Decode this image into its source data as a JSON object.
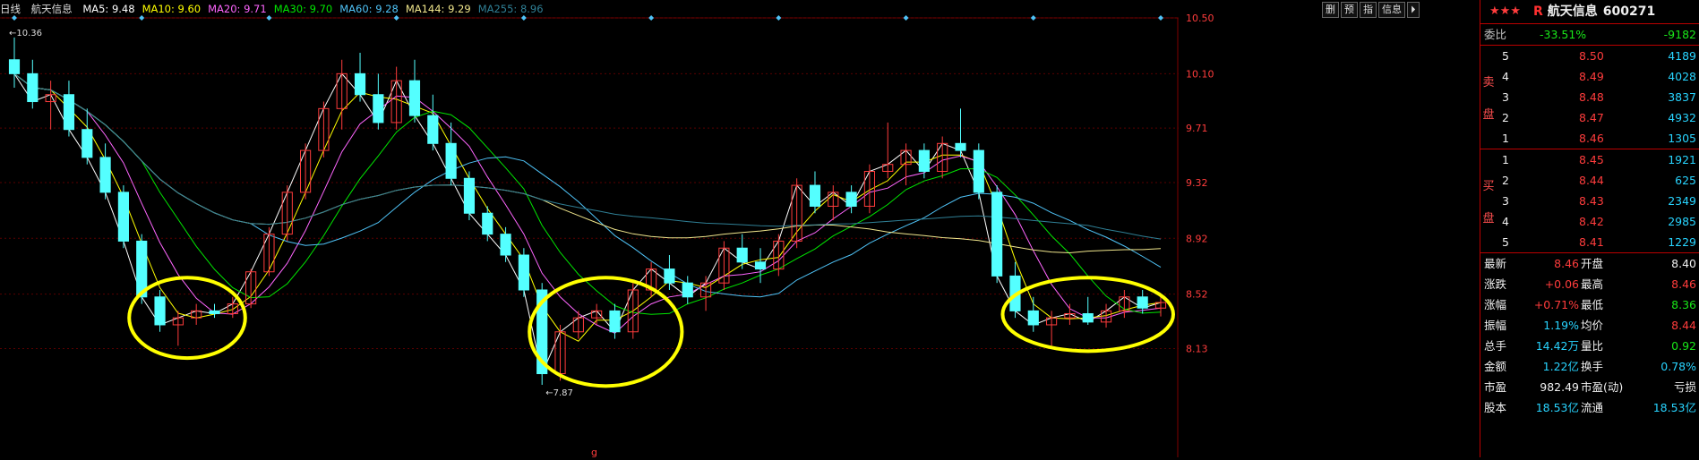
{
  "header": {
    "period": "日线",
    "stock_name": "航天信息",
    "ma_labels": [
      {
        "label": "MA5: 9.48",
        "color": "#ffffff"
      },
      {
        "label": "MA10: 9.60",
        "color": "#ffff00"
      },
      {
        "label": "MA20: 9.71",
        "color": "#ff66ff"
      },
      {
        "label": "MA30: 9.70",
        "color": "#00e600"
      },
      {
        "label": "MA60: 9.28",
        "color": "#4fc3f7"
      },
      {
        "label": "MA144: 9.29",
        "color": "#f0e68c"
      },
      {
        "label": "MA255: 8.96",
        "color": "#2f7f95"
      }
    ]
  },
  "toolbar": {
    "buttons": [
      "删",
      "预",
      "指",
      "信息",
      "⏵"
    ]
  },
  "chart_data": {
    "type": "candlestick",
    "ylim": [
      7.87,
      10.5
    ],
    "y_ticks": [
      "10.50",
      "10.10",
      "9.71",
      "9.32",
      "8.92",
      "8.52",
      "8.13"
    ],
    "max_label": "10.36",
    "min_label": "7.87",
    "x_marker": "g",
    "ohlc": [
      [
        10.2,
        10.36,
        10.0,
        10.1
      ],
      [
        10.1,
        10.2,
        9.85,
        9.9
      ],
      [
        9.9,
        10.05,
        9.7,
        9.95
      ],
      [
        9.95,
        10.05,
        9.65,
        9.7
      ],
      [
        9.7,
        9.85,
        9.45,
        9.5
      ],
      [
        9.5,
        9.6,
        9.2,
        9.25
      ],
      [
        9.25,
        9.3,
        8.85,
        8.9
      ],
      [
        8.9,
        8.95,
        8.45,
        8.5
      ],
      [
        8.5,
        8.55,
        8.25,
        8.3
      ],
      [
        8.3,
        8.4,
        8.15,
        8.35
      ],
      [
        8.35,
        8.45,
        8.3,
        8.4
      ],
      [
        8.4,
        8.45,
        8.35,
        8.38
      ],
      [
        8.38,
        8.5,
        8.35,
        8.45
      ],
      [
        8.45,
        8.7,
        8.42,
        8.68
      ],
      [
        8.68,
        9.0,
        8.65,
        8.95
      ],
      [
        8.95,
        9.3,
        8.9,
        9.25
      ],
      [
        9.25,
        9.6,
        9.2,
        9.55
      ],
      [
        9.55,
        9.9,
        9.5,
        9.85
      ],
      [
        9.85,
        10.2,
        9.7,
        10.1
      ],
      [
        10.1,
        10.25,
        9.9,
        9.95
      ],
      [
        9.95,
        10.1,
        9.7,
        9.75
      ],
      [
        9.75,
        10.15,
        9.7,
        10.05
      ],
      [
        10.05,
        10.2,
        9.75,
        9.8
      ],
      [
        9.8,
        9.95,
        9.55,
        9.6
      ],
      [
        9.6,
        9.75,
        9.3,
        9.35
      ],
      [
        9.35,
        9.4,
        9.05,
        9.1
      ],
      [
        9.1,
        9.15,
        8.9,
        8.95
      ],
      [
        8.95,
        9.0,
        8.75,
        8.8
      ],
      [
        8.8,
        8.85,
        8.5,
        8.55
      ],
      [
        8.55,
        8.6,
        7.87,
        7.95
      ],
      [
        7.95,
        8.3,
        7.9,
        8.25
      ],
      [
        8.25,
        8.4,
        8.2,
        8.35
      ],
      [
        8.35,
        8.45,
        8.3,
        8.4
      ],
      [
        8.4,
        8.45,
        8.2,
        8.25
      ],
      [
        8.25,
        8.6,
        8.2,
        8.55
      ],
      [
        8.55,
        8.75,
        8.5,
        8.7
      ],
      [
        8.7,
        8.8,
        8.55,
        8.6
      ],
      [
        8.6,
        8.65,
        8.45,
        8.5
      ],
      [
        8.5,
        8.65,
        8.4,
        8.6
      ],
      [
        8.6,
        8.9,
        8.55,
        8.85
      ],
      [
        8.85,
        8.95,
        8.7,
        8.75
      ],
      [
        8.75,
        8.85,
        8.6,
        8.7
      ],
      [
        8.7,
        8.95,
        8.65,
        8.9
      ],
      [
        8.9,
        9.35,
        8.85,
        9.3
      ],
      [
        9.3,
        9.4,
        9.1,
        9.15
      ],
      [
        9.15,
        9.3,
        9.05,
        9.25
      ],
      [
        9.25,
        9.3,
        9.1,
        9.15
      ],
      [
        9.15,
        9.45,
        9.1,
        9.4
      ],
      [
        9.4,
        9.75,
        9.35,
        9.45
      ],
      [
        9.45,
        9.6,
        9.3,
        9.55
      ],
      [
        9.55,
        9.6,
        9.35,
        9.4
      ],
      [
        9.4,
        9.65,
        9.35,
        9.6
      ],
      [
        9.6,
        9.85,
        9.5,
        9.55
      ],
      [
        9.55,
        9.6,
        9.2,
        9.25
      ],
      [
        9.25,
        9.3,
        8.6,
        8.65
      ],
      [
        8.65,
        8.75,
        8.35,
        8.4
      ],
      [
        8.4,
        8.5,
        8.25,
        8.3
      ],
      [
        8.3,
        8.4,
        8.15,
        8.35
      ],
      [
        8.35,
        8.45,
        8.3,
        8.38
      ],
      [
        8.38,
        8.5,
        8.3,
        8.32
      ],
      [
        8.32,
        8.45,
        8.28,
        8.4
      ],
      [
        8.4,
        8.55,
        8.35,
        8.5
      ],
      [
        8.5,
        8.55,
        8.38,
        8.42
      ],
      [
        8.42,
        8.52,
        8.36,
        8.46
      ]
    ]
  },
  "quote": {
    "stars": "★★★",
    "r_badge": "R",
    "name": "航天信息",
    "code": "600271",
    "weibi": {
      "label": "委比",
      "pct": "-33.51%",
      "diff": "-9182"
    },
    "sell_label": [
      "卖",
      "盘"
    ],
    "buy_label": [
      "买",
      "盘"
    ],
    "sell": [
      {
        "lvl": "5",
        "price": "8.50",
        "vol": "4189"
      },
      {
        "lvl": "4",
        "price": "8.49",
        "vol": "4028"
      },
      {
        "lvl": "3",
        "price": "8.48",
        "vol": "3837"
      },
      {
        "lvl": "2",
        "price": "8.47",
        "vol": "4932"
      },
      {
        "lvl": "1",
        "price": "8.46",
        "vol": "1305"
      }
    ],
    "buy": [
      {
        "lvl": "1",
        "price": "8.45",
        "vol": "1921"
      },
      {
        "lvl": "2",
        "price": "8.44",
        "vol": "625"
      },
      {
        "lvl": "3",
        "price": "8.43",
        "vol": "2349"
      },
      {
        "lvl": "4",
        "price": "8.42",
        "vol": "2985"
      },
      {
        "lvl": "5",
        "price": "8.41",
        "vol": "1229"
      }
    ],
    "stats": [
      {
        "l1": "最新",
        "v1": "8.46",
        "c1": "red",
        "l2": "开盘",
        "v2": "8.40",
        "c2": "white"
      },
      {
        "l1": "涨跌",
        "v1": "+0.06",
        "c1": "red",
        "l2": "最高",
        "v2": "8.46",
        "c2": "red"
      },
      {
        "l1": "涨幅",
        "v1": "+0.71%",
        "c1": "red",
        "l2": "最低",
        "v2": "8.36",
        "c2": "green"
      },
      {
        "l1": "振幅",
        "v1": "1.19%",
        "c1": "cyan",
        "l2": "均价",
        "v2": "8.44",
        "c2": "red"
      },
      {
        "l1": "总手",
        "v1": "14.42万",
        "c1": "cyan",
        "l2": "量比",
        "v2": "0.92",
        "c2": "green"
      },
      {
        "l1": "金额",
        "v1": "1.22亿",
        "c1": "cyan",
        "l2": "换手",
        "v2": "0.78%",
        "c2": "cyan"
      },
      {
        "l1": "市盈",
        "v1": "982.49",
        "c1": "white",
        "l2": "市盈(动)",
        "v2": "亏损",
        "c2": "white"
      },
      {
        "l1": "股本",
        "v1": "18.53亿",
        "c1": "cyan",
        "l2": "流通",
        "v2": "18.53亿",
        "c2": "cyan"
      }
    ]
  }
}
